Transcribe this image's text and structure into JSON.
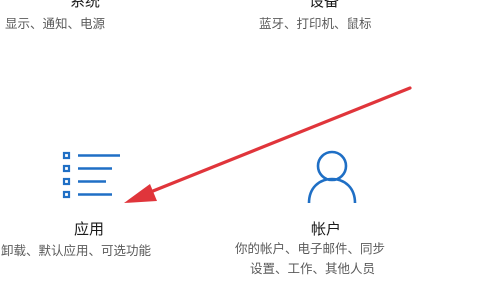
{
  "settings_tiles": [
    {
      "title": "系统",
      "description": [
        "显示、通知、电源"
      ],
      "icon": "laptop-icon"
    },
    {
      "title": "设备",
      "description": [
        "蓝牙、打印机、鼠标"
      ],
      "icon": "keyboard-icon"
    },
    {
      "title": "应用",
      "description": [
        "卸载、默认应用、可选功能"
      ],
      "icon": "apps-list-icon"
    },
    {
      "title": "帐户",
      "description": [
        "你的帐户、电子邮件、同步",
        "设置、工作、其他人员"
      ],
      "icon": "person-icon"
    }
  ],
  "annotation": {
    "type": "arrow",
    "color": "#e0353b",
    "points_to": "apps-list-icon"
  },
  "colors": {
    "accent": "#1f6fc5",
    "title_text": "#1a1a1a",
    "description_text": "#5a5a5a"
  }
}
